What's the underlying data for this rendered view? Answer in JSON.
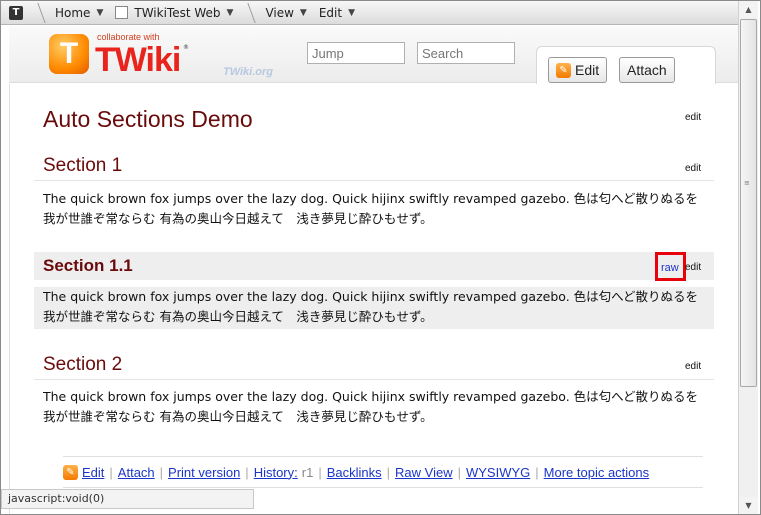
{
  "topbar": {
    "items": [
      {
        "label": "Home"
      },
      {
        "label": "TWikiTest Web"
      },
      {
        "label": "View"
      },
      {
        "label": "Edit"
      }
    ]
  },
  "header": {
    "logo_tagline": "collaborate with",
    "logo_word": "TWiki",
    "watermark": "TWiki.org",
    "jump_placeholder": "Jump",
    "search_placeholder": "Search",
    "edit_button": "Edit",
    "attach_button": "Attach"
  },
  "page": {
    "title": "Auto Sections Demo",
    "title_edit": "edit",
    "sections": [
      {
        "title": "Section 1",
        "edit": "edit",
        "line1": "The quick brown fox jumps over the lazy dog. Quick hijinx swiftly revamped gazebo. 色は匂へど散りぬるを",
        "line2": "我が世誰ぞ常ならむ 有為の奥山今日越えて　浅き夢見じ酔ひもせず。"
      },
      {
        "title": "Section 1.1",
        "raw": "raw",
        "edit": "edit",
        "line1": "The quick brown fox jumps over the lazy dog. Quick hijinx swiftly revamped gazebo. 色は匂へど散りぬるを",
        "line2": "我が世誰ぞ常ならむ 有為の奥山今日越えて　浅き夢見じ酔ひもせず。"
      },
      {
        "title": "Section 2",
        "edit": "edit",
        "line1": "The quick brown fox jumps over the lazy dog. Quick hijinx swiftly revamped gazebo. 色は匂へど散りぬるを",
        "line2": "我が世誰ぞ常ならむ 有為の奥山今日越えて　浅き夢見じ酔ひもせず。"
      }
    ]
  },
  "actions": {
    "edit": "Edit",
    "attach": "Attach",
    "print": "Print version",
    "history_label": "History:",
    "history_rev": "r1",
    "backlinks": "Backlinks",
    "raw_view": "Raw View",
    "wysiwyg": "WYSIWYG",
    "more": "More topic actions"
  },
  "status": {
    "text": "javascript:void(0)"
  },
  "colors": {
    "heading": "#6a0b0b",
    "link": "#1b35c8",
    "highlight": "#e8000a"
  }
}
